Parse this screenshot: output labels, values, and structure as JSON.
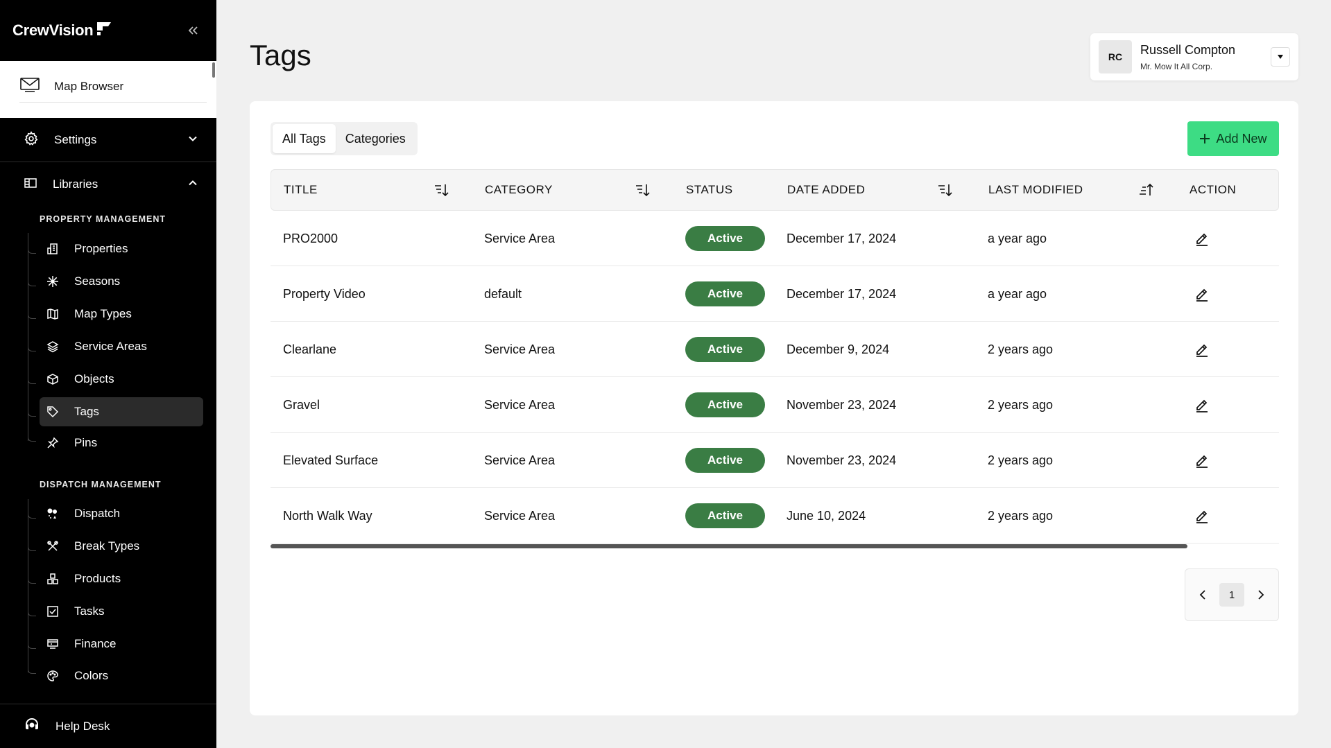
{
  "brand": {
    "name": "CrewVision"
  },
  "sidebar": {
    "map_browser": "Map Browser",
    "settings": "Settings",
    "libraries": "Libraries",
    "groups": [
      {
        "title": "PROPERTY MANAGEMENT",
        "items": [
          {
            "label": "Properties",
            "icon": "building-icon"
          },
          {
            "label": "Seasons",
            "icon": "snowflake-icon"
          },
          {
            "label": "Map Types",
            "icon": "map-icon"
          },
          {
            "label": "Service Areas",
            "icon": "layers-icon"
          },
          {
            "label": "Objects",
            "icon": "cube-icon"
          },
          {
            "label": "Tags",
            "icon": "tag-icon"
          },
          {
            "label": "Pins",
            "icon": "pin-icon"
          }
        ]
      },
      {
        "title": "DISPATCH MANAGEMENT",
        "items": [
          {
            "label": "Dispatch",
            "icon": "dispatch-icon"
          },
          {
            "label": "Break Types",
            "icon": "tools-icon"
          },
          {
            "label": "Products",
            "icon": "products-icon"
          },
          {
            "label": "Tasks",
            "icon": "checkbox-icon"
          },
          {
            "label": "Finance",
            "icon": "finance-icon"
          },
          {
            "label": "Colors",
            "icon": "palette-icon"
          }
        ]
      }
    ],
    "active_item": "Tags",
    "help_desk": "Help Desk"
  },
  "header": {
    "title": "Tags",
    "user": {
      "initials": "RC",
      "name": "Russell Compton",
      "org": "Mr. Mow It All Corp."
    }
  },
  "tabs": [
    "All Tags",
    "Categories"
  ],
  "active_tab": "All Tags",
  "add_button": "Add New",
  "table": {
    "columns": [
      "TITLE",
      "CATEGORY",
      "STATUS",
      "DATE ADDED",
      "LAST MODIFIED",
      "ACTION"
    ],
    "rows": [
      {
        "title": "PRO2000",
        "category": "Service Area",
        "status": "Active",
        "date_added": "December 17, 2024",
        "last_modified": "a year ago"
      },
      {
        "title": "Property Video",
        "category": "default",
        "status": "Active",
        "date_added": "December 17, 2024",
        "last_modified": "a year ago"
      },
      {
        "title": "Clearlane",
        "category": "Service Area",
        "status": "Active",
        "date_added": "December 9, 2024",
        "last_modified": "2 years ago"
      },
      {
        "title": "Gravel",
        "category": "Service Area",
        "status": "Active",
        "date_added": "November 23, 2024",
        "last_modified": "2 years ago"
      },
      {
        "title": "Elevated Surface",
        "category": "Service Area",
        "status": "Active",
        "date_added": "November 23, 2024",
        "last_modified": "2 years ago"
      },
      {
        "title": "North Walk Way",
        "category": "Service Area",
        "status": "Active",
        "date_added": "June 10, 2024",
        "last_modified": "2 years ago"
      }
    ]
  },
  "pagination": {
    "current_page": "1"
  },
  "colors": {
    "accent": "#3ddc84",
    "status_active": "#3a7d44",
    "sidebar_bg": "#000000"
  }
}
